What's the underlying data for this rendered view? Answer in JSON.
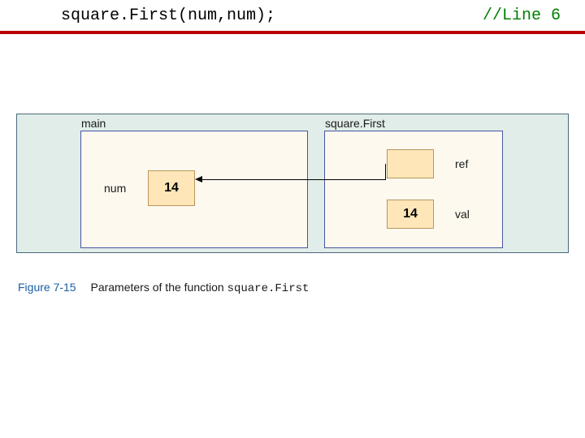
{
  "header": {
    "codeLeft": "square.First(num,num);",
    "codeRight": "//Line 6"
  },
  "diagram": {
    "main": {
      "title": "main",
      "varLabel": "num",
      "value": "14"
    },
    "squareFirst": {
      "title": "square.First",
      "ref": {
        "label": "ref",
        "value": ""
      },
      "val": {
        "label": "val",
        "value": "14"
      }
    }
  },
  "caption": {
    "figNum": "Figure 7-15",
    "text": "Parameters of the function ",
    "funcName": "square.First"
  }
}
